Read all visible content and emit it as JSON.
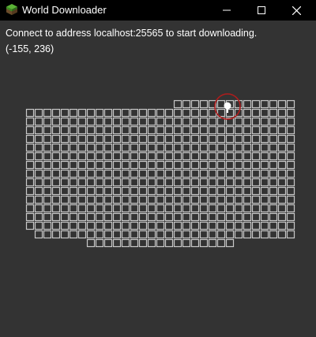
{
  "window": {
    "title": "World Downloader",
    "icon": "minecraft-grass-block-icon",
    "controls": [
      "minimize-icon",
      "maximize-icon",
      "close-icon"
    ]
  },
  "status": {
    "message": "Connect to address localhost:25565 to start downloading.",
    "coordinates": "(-155, 236)"
  },
  "colors": {
    "titlebar": "#000000",
    "background": "#333333",
    "chunk_outline": "#c8c8c8",
    "player_marker_ring": "#b01c1c",
    "player_marker_dot": "#ffffff"
  }
}
